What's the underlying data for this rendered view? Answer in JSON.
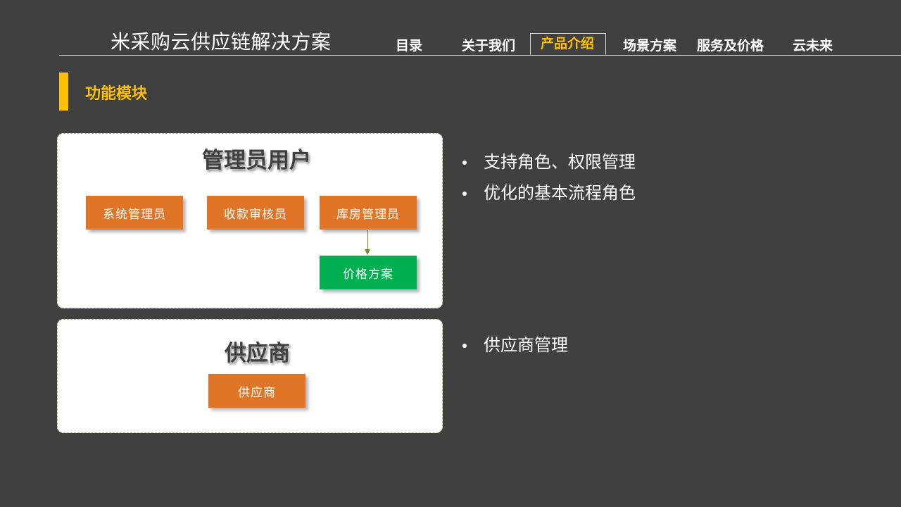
{
  "header": {
    "brand_title": "米采购云供应链解决方案"
  },
  "nav": {
    "tabs": [
      {
        "label": "目录",
        "active": false
      },
      {
        "label": "关于我们",
        "active": false
      },
      {
        "label": "产品介绍",
        "active": true
      },
      {
        "label": "场景方案",
        "active": false
      },
      {
        "label": "服务及价格",
        "active": false
      },
      {
        "label": "云未来",
        "active": false
      }
    ]
  },
  "section": {
    "title": "功能模块"
  },
  "admin_panel": {
    "title": "管理员用户",
    "roles": [
      "系统管理员",
      "收款审核员",
      "库房管理员"
    ],
    "linked_item": "价格方案",
    "bullets": [
      "支持角色、权限管理",
      "优化的基本流程角色"
    ]
  },
  "supplier_panel": {
    "title": "供应商",
    "roles": [
      "供应商"
    ],
    "bullets": [
      "供应商管理"
    ]
  },
  "colors": {
    "background": "#404040",
    "accent": "#ffc000",
    "role_box": "#e07528",
    "linked_box": "#00b050",
    "connector": "#6b8e23"
  }
}
